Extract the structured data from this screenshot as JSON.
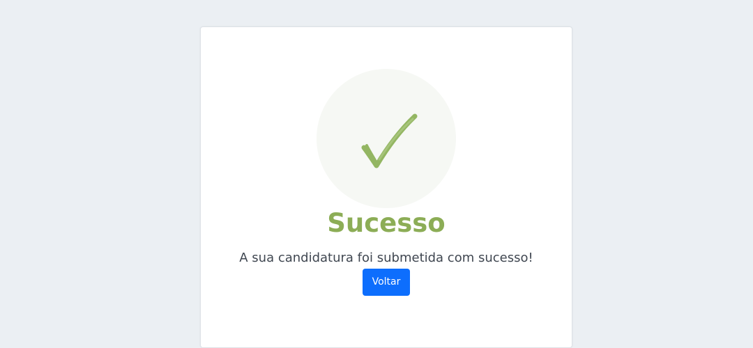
{
  "result": {
    "icon": "checkmark-icon",
    "title": "Sucesso",
    "message": "A sua candidatura foi submetida com sucesso!",
    "back_button_label": "Voltar"
  },
  "colors": {
    "page_background": "#ebeff3",
    "card_background": "#ffffff",
    "icon_circle": "#f6f8f4",
    "success_green": "#8cad56",
    "checkmark_green": "#93b662",
    "text": "#3f4650",
    "primary_button": "#0d6efd"
  }
}
